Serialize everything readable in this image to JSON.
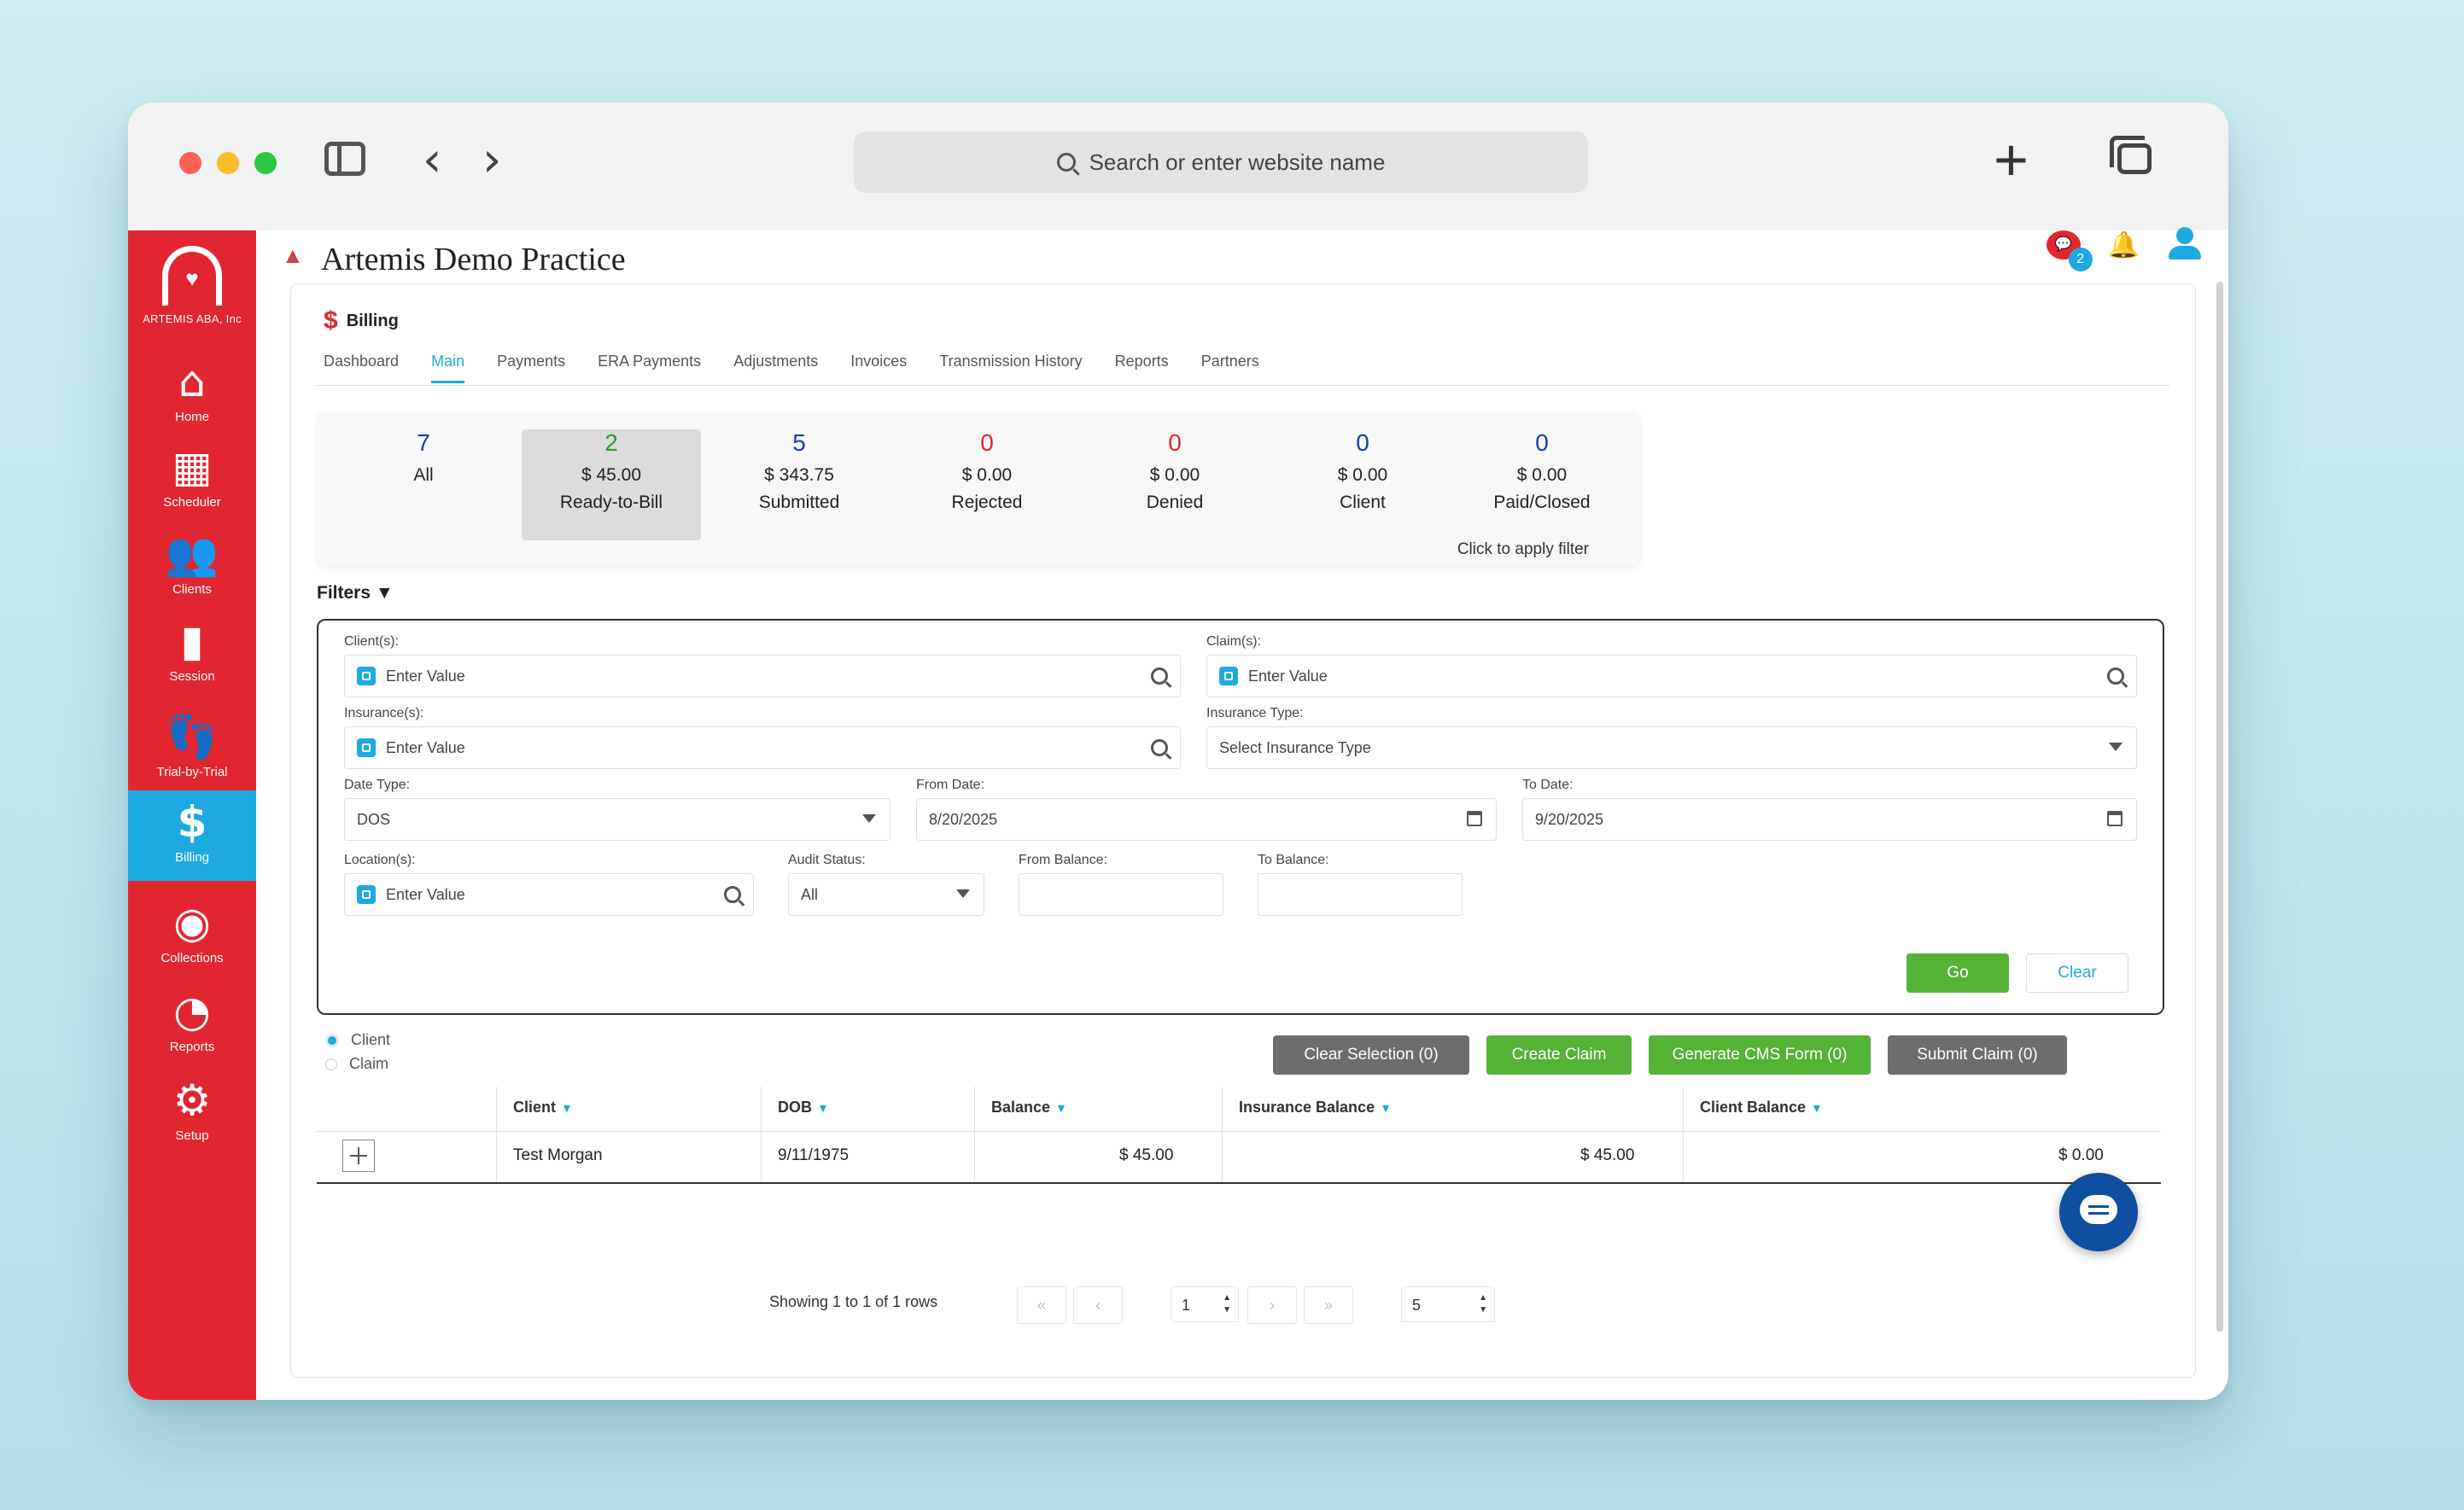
{
  "browser": {
    "search_placeholder": "Search or enter website name"
  },
  "app": {
    "org": "ARTEMIS ABA, Inc",
    "practice": "Artemis Demo Practice",
    "chat_count": "2"
  },
  "sidebar": {
    "items": [
      {
        "label": "Home",
        "icon": "home-icon"
      },
      {
        "label": "Scheduler",
        "icon": "calendar-icon"
      },
      {
        "label": "Clients",
        "icon": "people-icon"
      },
      {
        "label": "Session",
        "icon": "session-icon"
      },
      {
        "label": "Trial-by-Trial",
        "icon": "footsteps-icon"
      },
      {
        "label": "Billing",
        "icon": "dollar-icon"
      },
      {
        "label": "Collections",
        "icon": "collections-icon"
      },
      {
        "label": "Reports",
        "icon": "pie-chart-icon"
      },
      {
        "label": "Setup",
        "icon": "gear-icon"
      }
    ]
  },
  "billing": {
    "title": "Billing",
    "tabs": [
      "Dashboard",
      "Main",
      "Payments",
      "ERA Payments",
      "Adjustments",
      "Invoices",
      "Transmission History",
      "Reports",
      "Partners"
    ],
    "active_tab": "Main"
  },
  "stats": {
    "items": [
      {
        "count": "7",
        "amount": "",
        "label": "All",
        "color": "#1a3fa8"
      },
      {
        "count": "2",
        "amount": "$ 45.00",
        "label": "Ready-to-Bill",
        "color": "#2e9a2e"
      },
      {
        "count": "5",
        "amount": "$ 343.75",
        "label": "Submitted",
        "color": "#1a3fa8"
      },
      {
        "count": "0",
        "amount": "$ 0.00",
        "label": "Rejected",
        "color": "#e2262f"
      },
      {
        "count": "0",
        "amount": "$ 0.00",
        "label": "Denied",
        "color": "#e2262f"
      },
      {
        "count": "0",
        "amount": "$ 0.00",
        "label": "Client",
        "color": "#1a3fa8"
      },
      {
        "count": "0",
        "amount": "$ 0.00",
        "label": "Paid/Closed",
        "color": "#1a3fa8"
      }
    ],
    "hint": "Click to apply filter"
  },
  "filters": {
    "title": "Filters ▼",
    "clients_label": "Client(s):",
    "clients_placeholder": "Enter Value",
    "claims_label": "Claim(s):",
    "claims_placeholder": "Enter Value",
    "insurance_label": "Insurance(s):",
    "insurance_placeholder": "Enter Value",
    "insurance_type_label": "Insurance Type:",
    "insurance_type_value": "Select Insurance Type",
    "date_type_label": "Date Type:",
    "date_type_value": "DOS",
    "from_date_label": "From Date:",
    "from_date_value": "8/20/2025",
    "to_date_label": "To Date:",
    "to_date_value": "9/20/2025",
    "location_label": "Location(s):",
    "location_placeholder": "Enter Value",
    "audit_label": "Audit Status:",
    "audit_value": "All",
    "from_balance_label": "From Balance:",
    "to_balance_label": "To Balance:",
    "go": "Go",
    "clear": "Clear"
  },
  "view_mode": {
    "client": "Client",
    "claim": "Claim"
  },
  "actions": {
    "clear_selection": "Clear Selection (0)",
    "create_claim": "Create Claim",
    "generate_cms": "Generate CMS Form (0)",
    "submit_claim": "Submit Claim (0)"
  },
  "table": {
    "headers": [
      "Client",
      "DOB",
      "Balance",
      "Insurance Balance",
      "Client Balance"
    ],
    "rows": [
      {
        "client": "Test Morgan",
        "dob": "9/11/1975",
        "balance": "$ 45.00",
        "insurance_balance": "$ 45.00",
        "client_balance": "$ 0.00"
      }
    ]
  },
  "pager": {
    "summary": "Showing 1 to 1 of 1 rows",
    "page": "1",
    "page_size": "5"
  }
}
